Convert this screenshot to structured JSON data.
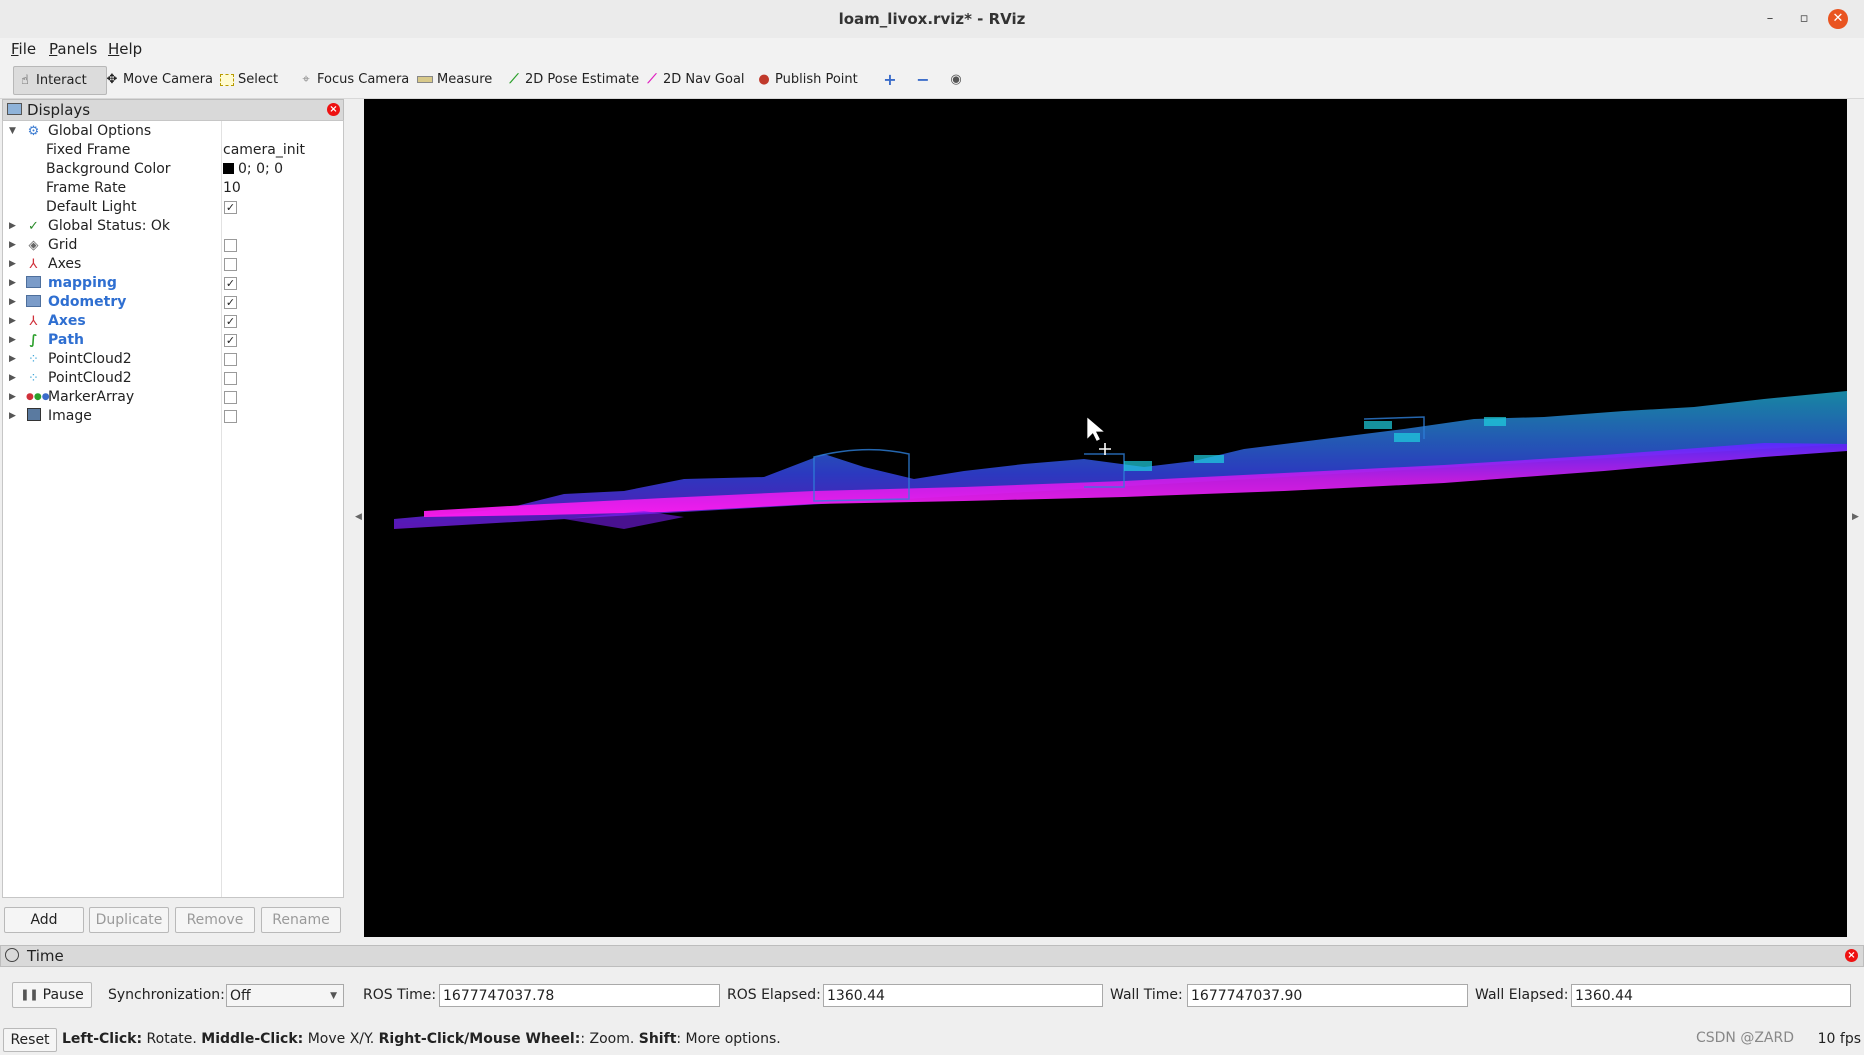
{
  "window": {
    "title": "loam_livox.rviz* - RViz",
    "min": "–",
    "max": "▫",
    "close": "✕"
  },
  "menu": {
    "file_mn": "F",
    "file_rest": "ile",
    "panels_mn": "P",
    "panels_rest": "anels",
    "help_mn": "H",
    "help_rest": "elp"
  },
  "toolbar": {
    "interact": "Interact",
    "move_camera": "Move Camera",
    "select": "Select",
    "focus_camera": "Focus Camera",
    "measure": "Measure",
    "pose_estimate": "2D Pose Estimate",
    "nav_goal": "2D Nav Goal",
    "publish_point": "Publish Point"
  },
  "displays": {
    "title": "Displays",
    "global_options": "Global Options",
    "fixed_frame_label": "Fixed Frame",
    "fixed_frame_value": "camera_init",
    "bg_color_label": "Background Color",
    "bg_color_value": "0; 0; 0",
    "frame_rate_label": "Frame Rate",
    "frame_rate_value": "10",
    "default_light_label": "Default Light",
    "global_status": "Global Status: Ok",
    "items": [
      "Grid",
      "Axes",
      "mapping",
      "Odometry",
      "Axes",
      "Path",
      "PointCloud2",
      "PointCloud2",
      "MarkerArray",
      "Image"
    ],
    "buttons": {
      "add": "Add",
      "duplicate": "Duplicate",
      "remove": "Remove",
      "rename": "Rename"
    }
  },
  "time": {
    "title": "Time",
    "pause": "Pause",
    "sync_label": "Synchronization:",
    "sync_value": "Off",
    "ros_time_label": "ROS Time:",
    "ros_time": "1677747037.78",
    "ros_elapsed_label": "ROS Elapsed:",
    "ros_elapsed": "1360.44",
    "wall_time_label": "Wall Time:",
    "wall_time": "1677747037.90",
    "wall_elapsed_label": "Wall Elapsed:",
    "wall_elapsed": "1360.44"
  },
  "status": {
    "reset": "Reset",
    "lc": "Left-Click:",
    "lc_t": " Rotate. ",
    "mc": "Middle-Click:",
    "mc_t": " Move X/Y. ",
    "rc": "Right-Click/Mouse Wheel:",
    "rc_t": ": Zoom. ",
    "sh": "Shift",
    "sh_t": ": More options.",
    "fps": "10 fps",
    "watermark": "CSDN @ZARD"
  }
}
